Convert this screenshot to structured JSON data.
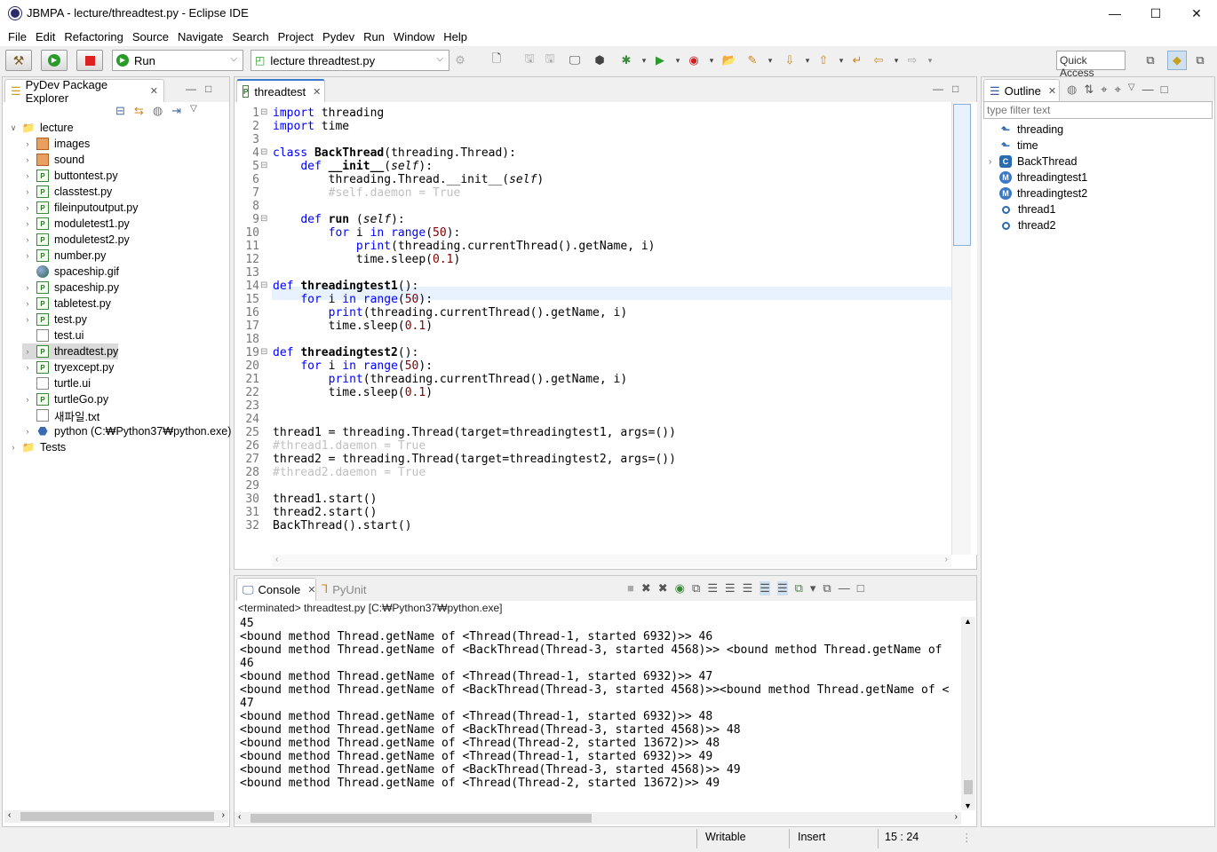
{
  "window": {
    "title": "JBMPA - lecture/threadtest.py - Eclipse IDE"
  },
  "menu": [
    "File",
    "Edit",
    "Refactoring",
    "Source",
    "Navigate",
    "Search",
    "Project",
    "Pydev",
    "Run",
    "Window",
    "Help"
  ],
  "toolbar": {
    "run_combo": "Run",
    "config_combo": "lecture threadtest.py",
    "quick_access": "Quick Access"
  },
  "explorer": {
    "tab_label": "PyDev Package Explorer",
    "project": "lecture",
    "items": [
      {
        "label": "images",
        "kind": "package",
        "expandable": true
      },
      {
        "label": "sound",
        "kind": "package",
        "expandable": true
      },
      {
        "label": "buttontest.py",
        "kind": "py",
        "expandable": true
      },
      {
        "label": "classtest.py",
        "kind": "py",
        "expandable": true
      },
      {
        "label": "fileinputoutput.py",
        "kind": "py",
        "expandable": true
      },
      {
        "label": "moduletest1.py",
        "kind": "py",
        "expandable": true
      },
      {
        "label": "moduletest2.py",
        "kind": "py",
        "expandable": true
      },
      {
        "label": "number.py",
        "kind": "py",
        "expandable": true
      },
      {
        "label": "spaceship.gif",
        "kind": "gif",
        "expandable": false
      },
      {
        "label": "spaceship.py",
        "kind": "py",
        "expandable": true
      },
      {
        "label": "tabletest.py",
        "kind": "py",
        "expandable": true
      },
      {
        "label": "test.py",
        "kind": "py",
        "expandable": true
      },
      {
        "label": "test.ui",
        "kind": "txt",
        "expandable": false
      },
      {
        "label": "threadtest.py",
        "kind": "py",
        "expandable": true,
        "selected": true
      },
      {
        "label": "tryexcept.py",
        "kind": "py",
        "expandable": true
      },
      {
        "label": "turtle.ui",
        "kind": "txt",
        "expandable": false
      },
      {
        "label": "turtleGo.py",
        "kind": "py",
        "expandable": true
      },
      {
        "label": "새파일.txt",
        "kind": "txt",
        "expandable": false
      },
      {
        "label": "python  (C:₩Python37₩python.exe)",
        "kind": "python",
        "expandable": true
      }
    ],
    "second_project": "Tests"
  },
  "editor": {
    "tab_label": "threadtest",
    "lines": [
      "import threading",
      "import time",
      "",
      "class BackThread(threading.Thread):",
      "    def __init__(self):",
      "        threading.Thread.__init__(self)",
      "        #self.daemon = True",
      "",
      "    def run (self):",
      "        for i in range(50):",
      "            print(threading.currentThread().getName, i)",
      "            time.sleep(0.1)",
      "",
      "def threadingtest1():",
      "    for i in range(50):",
      "        print(threading.currentThread().getName, i)",
      "        time.sleep(0.1)",
      "",
      "def threadingtest2():",
      "    for i in range(50):",
      "        print(threading.currentThread().getName, i)",
      "        time.sleep(0.1)",
      "",
      "",
      "thread1 = threading.Thread(target=threadingtest1, args=())",
      "#thread1.daemon = True",
      "thread2 = threading.Thread(target=threadingtest2, args=())",
      "#thread2.daemon = True",
      "",
      "thread1.start()",
      "thread2.start()",
      "BackThread().start()"
    ],
    "current_line": 15
  },
  "console": {
    "tab_label": "Console",
    "tab2_label": "PyUnit",
    "header": "<terminated> threadtest.py [C:₩Python37₩python.exe]",
    "lines": [
      "45",
      "<bound method Thread.getName of <Thread(Thread-1, started 6932)>> 46",
      "<bound method Thread.getName of <BackThread(Thread-3, started 4568)>> <bound method Thread.getName of",
      "46",
      "<bound method Thread.getName of <Thread(Thread-1, started 6932)>> 47",
      "<bound method Thread.getName of <BackThread(Thread-3, started 4568)>><bound method Thread.getName of <",
      "47",
      "<bound method Thread.getName of <Thread(Thread-1, started 6932)>> 48",
      "<bound method Thread.getName of <BackThread(Thread-3, started 4568)>> 48",
      "<bound method Thread.getName of <Thread(Thread-2, started 13672)>> 48",
      "<bound method Thread.getName of <Thread(Thread-1, started 6932)>> 49",
      "<bound method Thread.getName of <BackThread(Thread-3, started 4568)>> 49",
      "<bound method Thread.getName of <Thread(Thread-2, started 13672)>> 49"
    ]
  },
  "outline": {
    "tab_label": "Outline",
    "filter_placeholder": "type filter text",
    "items": [
      {
        "label": "threading",
        "kind": "import"
      },
      {
        "label": "time",
        "kind": "import"
      },
      {
        "label": "BackThread",
        "kind": "class",
        "expandable": true
      },
      {
        "label": "threadingtest1",
        "kind": "method"
      },
      {
        "label": "threadingtest2",
        "kind": "method"
      },
      {
        "label": "thread1",
        "kind": "attr"
      },
      {
        "label": "thread2",
        "kind": "attr"
      }
    ]
  },
  "status": {
    "writable": "Writable",
    "insert": "Insert",
    "position": "15 : 24"
  }
}
